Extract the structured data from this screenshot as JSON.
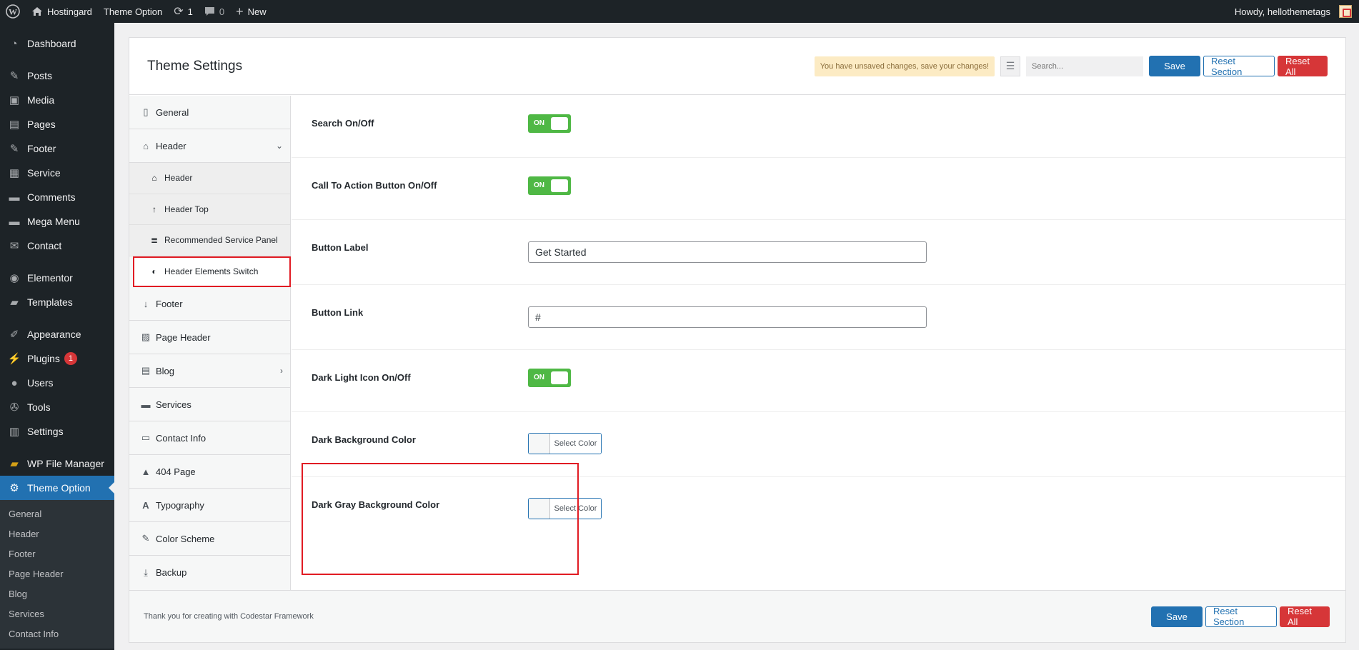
{
  "adminbar": {
    "site_name": "Hostingard",
    "theme_option": "Theme Option",
    "updates_count": "1",
    "comments_count": "0",
    "new_label": "New",
    "howdy": "Howdy, hellothemetags"
  },
  "sidebar": {
    "items": [
      {
        "label": "Dashboard",
        "icon": "dashboard-icon"
      },
      {
        "label": "Posts",
        "icon": "pin-icon"
      },
      {
        "label": "Media",
        "icon": "media-icon"
      },
      {
        "label": "Pages",
        "icon": "pages-icon"
      },
      {
        "label": "Footer",
        "icon": "pin-icon"
      },
      {
        "label": "Service",
        "icon": "service-icon"
      },
      {
        "label": "Comments",
        "icon": "comment-icon"
      },
      {
        "label": "Mega Menu",
        "icon": "comment-icon"
      },
      {
        "label": "Contact",
        "icon": "mail-icon"
      },
      {
        "label": "Elementor",
        "icon": "elementor-icon"
      },
      {
        "label": "Templates",
        "icon": "folder-icon"
      },
      {
        "label": "Appearance",
        "icon": "brush-icon"
      },
      {
        "label": "Plugins",
        "icon": "plugin-icon",
        "badge": "1"
      },
      {
        "label": "Users",
        "icon": "user-icon"
      },
      {
        "label": "Tools",
        "icon": "wrench-icon"
      },
      {
        "label": "Settings",
        "icon": "settings-icon"
      },
      {
        "label": "WP File Manager",
        "icon": "file-manager-icon"
      },
      {
        "label": "Theme Option",
        "icon": "gear-icon"
      }
    ],
    "submenu": [
      "General",
      "Header",
      "Footer",
      "Page Header",
      "Blog",
      "Services",
      "Contact Info"
    ]
  },
  "panel": {
    "title": "Theme Settings",
    "unsaved": "You have unsaved changes, save your changes!",
    "search_placeholder": "Search...",
    "save": "Save",
    "reset_section": "Reset Section",
    "reset_all": "Reset All",
    "footer_credit": "Thank you for creating with Codestar Framework"
  },
  "nav": {
    "general": "General",
    "header": "Header",
    "sub": [
      "Header",
      "Header Top",
      "Recommended Service Panel",
      "Header Elements Switch"
    ],
    "items": [
      "Footer",
      "Page Header",
      "Blog",
      "Services",
      "Contact Info",
      "404 Page",
      "Typography",
      "Color Scheme",
      "Backup"
    ]
  },
  "fields": {
    "search": {
      "title": "Search On/Off",
      "state": "ON"
    },
    "cta": {
      "title": "Call To Action Button On/Off",
      "state": "ON"
    },
    "button_label": {
      "title": "Button Label",
      "value": "Get Started"
    },
    "button_link": {
      "title": "Button Link",
      "value": "#"
    },
    "dark_light": {
      "title": "Dark Light Icon On/Off",
      "state": "ON"
    },
    "dark_bg": {
      "title": "Dark Background Color",
      "button": "Select Color"
    },
    "dark_gray_bg": {
      "title": "Dark Gray Background Color",
      "button": "Select Color"
    }
  },
  "colors": {
    "accent": "#2271b1",
    "danger": "#d63638",
    "switch_on": "#4fb845",
    "highlight": "#e11b23"
  }
}
